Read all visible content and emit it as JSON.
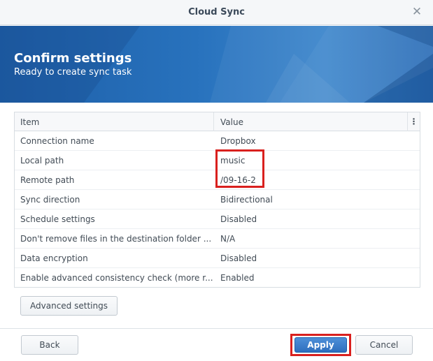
{
  "window": {
    "title": "Cloud Sync",
    "close_icon": "close-icon"
  },
  "banner": {
    "heading": "Confirm settings",
    "subheading": "Ready to create sync task"
  },
  "grid": {
    "columns": [
      "Item",
      "Value"
    ],
    "menu_glyph": "⋮",
    "rows": [
      {
        "item": "Connection name",
        "value": "Dropbox"
      },
      {
        "item": "Local path",
        "value": "music"
      },
      {
        "item": "Remote path",
        "value": "/09-16-2"
      },
      {
        "item": "Sync direction",
        "value": "Bidirectional"
      },
      {
        "item": "Schedule settings",
        "value": "Disabled"
      },
      {
        "item": "Don't remove files in the destination folder ...",
        "value": "N/A"
      },
      {
        "item": "Data encryption",
        "value": "Disabled"
      },
      {
        "item": "Enable advanced consistency check (more r...",
        "value": "Enabled"
      }
    ]
  },
  "buttons": {
    "advanced": "Advanced settings",
    "back": "Back",
    "apply": "Apply",
    "cancel": "Cancel"
  },
  "colors": {
    "banner": "#2872bd",
    "primary_button": "#2f6fbe",
    "highlight": "#d9201e"
  }
}
